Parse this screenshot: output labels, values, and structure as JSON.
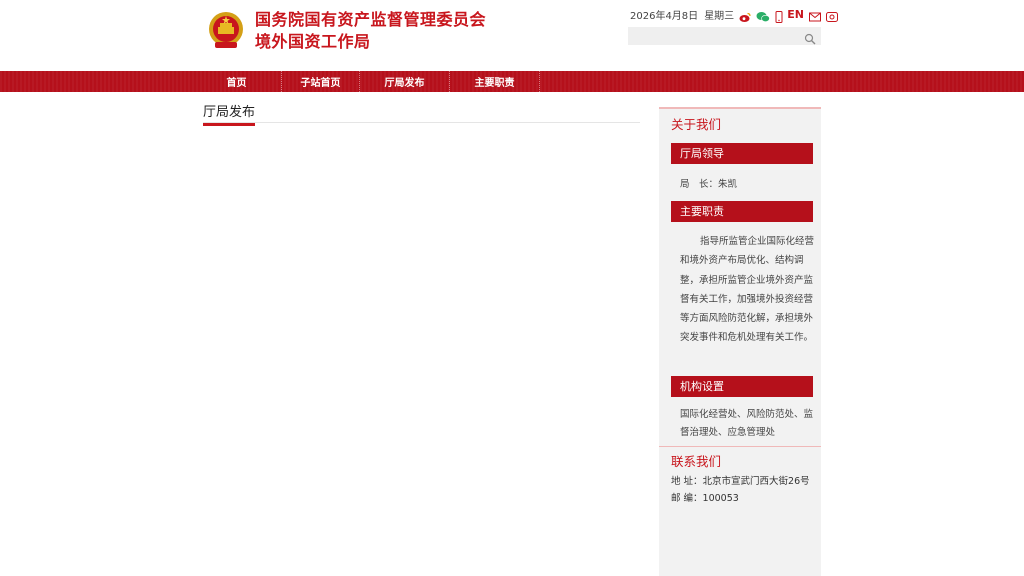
{
  "header": {
    "title_line1": "国务院国有资产监督管理委员会",
    "title_line2": "境外国资工作局",
    "date": "2026年4月8日",
    "weekday": "星期三",
    "lang_label": "EN",
    "search_placeholder": "",
    "accent_color": "#c8161d",
    "icons": [
      "weibo-icon",
      "wechat-icon",
      "mobile-icon",
      "mail-icon",
      "accessibility-icon",
      "search-icon"
    ]
  },
  "nav": {
    "items": [
      "首页",
      "子站首页",
      "厅局发布",
      "主要职责"
    ]
  },
  "main": {
    "section_title": "厅局发布"
  },
  "sidebar": {
    "about_title": "关于我们",
    "leadership_title": "厅局领导",
    "leadership_text": "局　长：朱凯",
    "duties_title": "主要职责",
    "duties_text": "指导所监管企业国际化经营和境外资产布局优化、结构调整，承担所监管企业境外资产监督有关工作，加强境外投资经营等方面风险防范化解，承担境外突发事件和危机处理有关工作。",
    "org_title": "机构设置",
    "org_text": "国际化经营处、风险防范处、监督治理处、应急管理处",
    "contact_title": "联系我们",
    "address": "地 址：北京市宣武门西大街26号",
    "postcode": "邮 编：100053"
  }
}
